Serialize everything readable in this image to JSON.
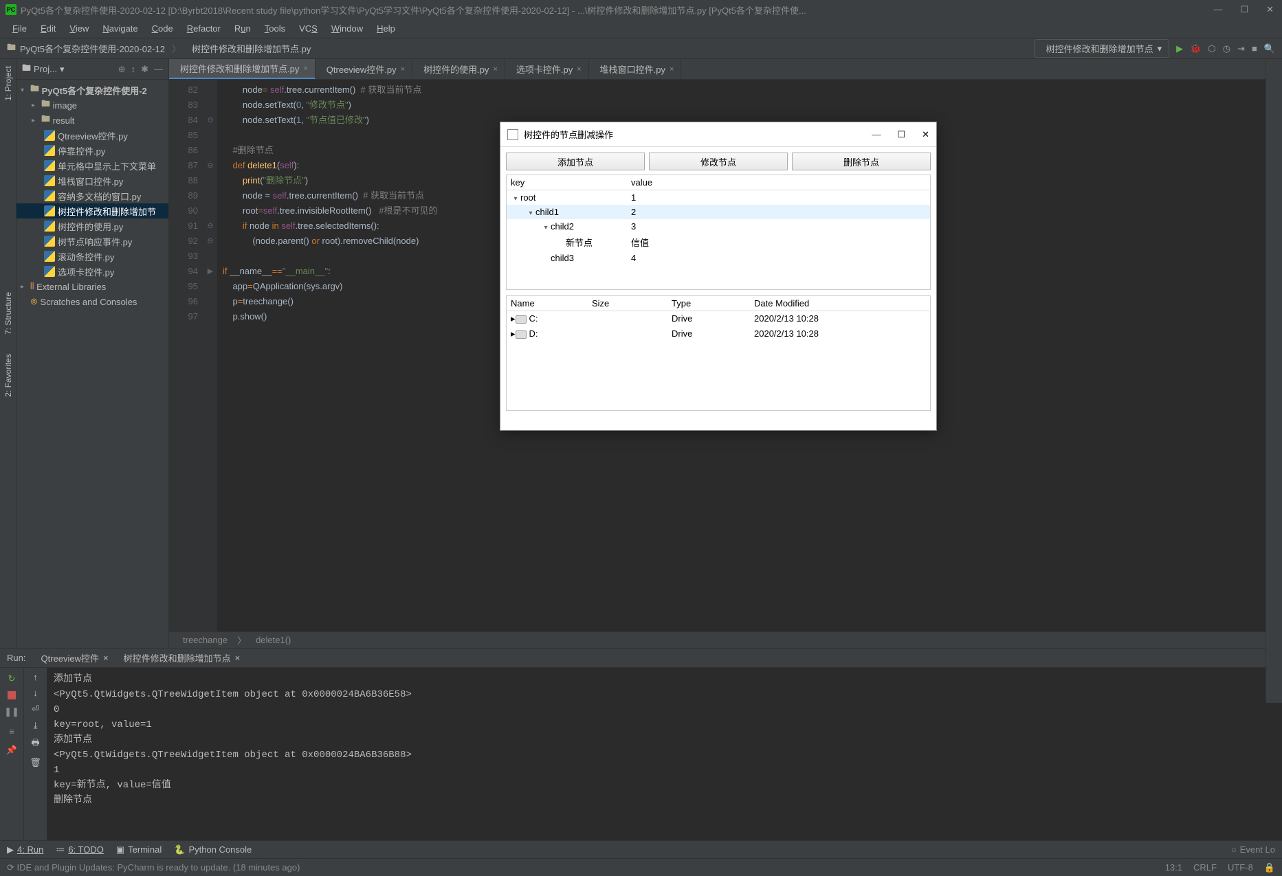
{
  "title": "PyQt5各个复杂控件使用-2020-02-12 [D:\\Byrbt2018\\Recent study file\\python学习文件\\PyQt5学习文件\\PyQt5各个复杂控件使用-2020-02-12] - ...\\树控件修改和删除增加节点.py [PyQt5各个复杂控件使...",
  "menu": {
    "file": "File",
    "edit": "Edit",
    "view": "View",
    "navigate": "Navigate",
    "code": "Code",
    "refactor": "Refactor",
    "run": "Run",
    "tools": "Tools",
    "vcs": "VCS",
    "window": "Window",
    "help": "Help"
  },
  "breadcrumb": {
    "folder": "PyQt5各个复杂控件使用-2020-02-12",
    "file": "树控件修改和删除增加节点.py"
  },
  "run_config": "树控件修改和删除增加节点",
  "project_panel_title": "Proj...",
  "project_tree": {
    "root": "PyQt5各个复杂控件使用-2",
    "folders": [
      "image",
      "result"
    ],
    "files": [
      "Qtreeview控件.py",
      "停靠控件.py",
      "单元格中显示上下文菜单",
      "堆栈窗口控件.py",
      "容纳多文档的窗口.py",
      "树控件修改和删除增加节",
      "树控件的使用.py",
      "树节点响应事件.py",
      "滚动条控件.py",
      "选项卡控件.py"
    ],
    "external": "External Libraries",
    "scratches": "Scratches and Consoles"
  },
  "selected_file_index": 5,
  "tabs": [
    {
      "label": "树控件修改和删除增加节点.py",
      "active": true
    },
    {
      "label": "Qtreeview控件.py"
    },
    {
      "label": "树控件的使用.py"
    },
    {
      "label": "选项卡控件.py"
    },
    {
      "label": "堆栈窗口控件.py"
    }
  ],
  "line_start": 82,
  "line_end": 97,
  "code_breadcrumb": {
    "cls": "treechange",
    "fn": "delete1()"
  },
  "run_tabs": {
    "label": "Run:",
    "t1": "Qtreeview控件",
    "t2": "树控件修改和删除增加节点"
  },
  "console_lines": [
    "添加节点",
    "<PyQt5.QtWidgets.QTreeWidgetItem object at 0x0000024BA6B36E58>",
    "0",
    "key=root, value=1",
    "添加节点",
    "<PyQt5.QtWidgets.QTreeWidgetItem object at 0x0000024BA6B36B88>",
    "1",
    "key=新节点, value=信值",
    "删除节点"
  ],
  "bottom_tools": {
    "run": "4: Run",
    "todo": "6: TODO",
    "terminal": "Terminal",
    "pyconsole": "Python Console",
    "eventlog": "Event Lo"
  },
  "status_msg": "IDE and Plugin Updates: PyCharm is ready to update. (18 minutes ago)",
  "status_right": {
    "pos": "13:1",
    "eol": "CRLF",
    "enc": "UTF-8"
  },
  "left_tool_labels": {
    "project": "1: Project",
    "structure": "7: Structure",
    "favorites": "2: Favorites"
  },
  "qt": {
    "title": "树控件的节点删减操作",
    "buttons": {
      "add": "添加节点",
      "modify": "修改节点",
      "delete": "删除节点"
    },
    "tree_headers": {
      "key": "key",
      "value": "value"
    },
    "tree": [
      {
        "k": "root",
        "v": "1",
        "indent": 0,
        "open": true
      },
      {
        "k": "child1",
        "v": "2",
        "indent": 1,
        "open": true,
        "sel": true
      },
      {
        "k": "child2",
        "v": "3",
        "indent": 2,
        "open": true
      },
      {
        "k": "新节点",
        "v": "信值",
        "indent": 3
      },
      {
        "k": "child3",
        "v": "4",
        "indent": 2
      }
    ],
    "fs_headers": {
      "name": "Name",
      "size": "Size",
      "type": "Type",
      "date": "Date Modified"
    },
    "fs": [
      {
        "name": "C:",
        "type": "Drive",
        "date": "2020/2/13 10:28"
      },
      {
        "name": "D:",
        "type": "Drive",
        "date": "2020/2/13 10:28"
      }
    ]
  }
}
